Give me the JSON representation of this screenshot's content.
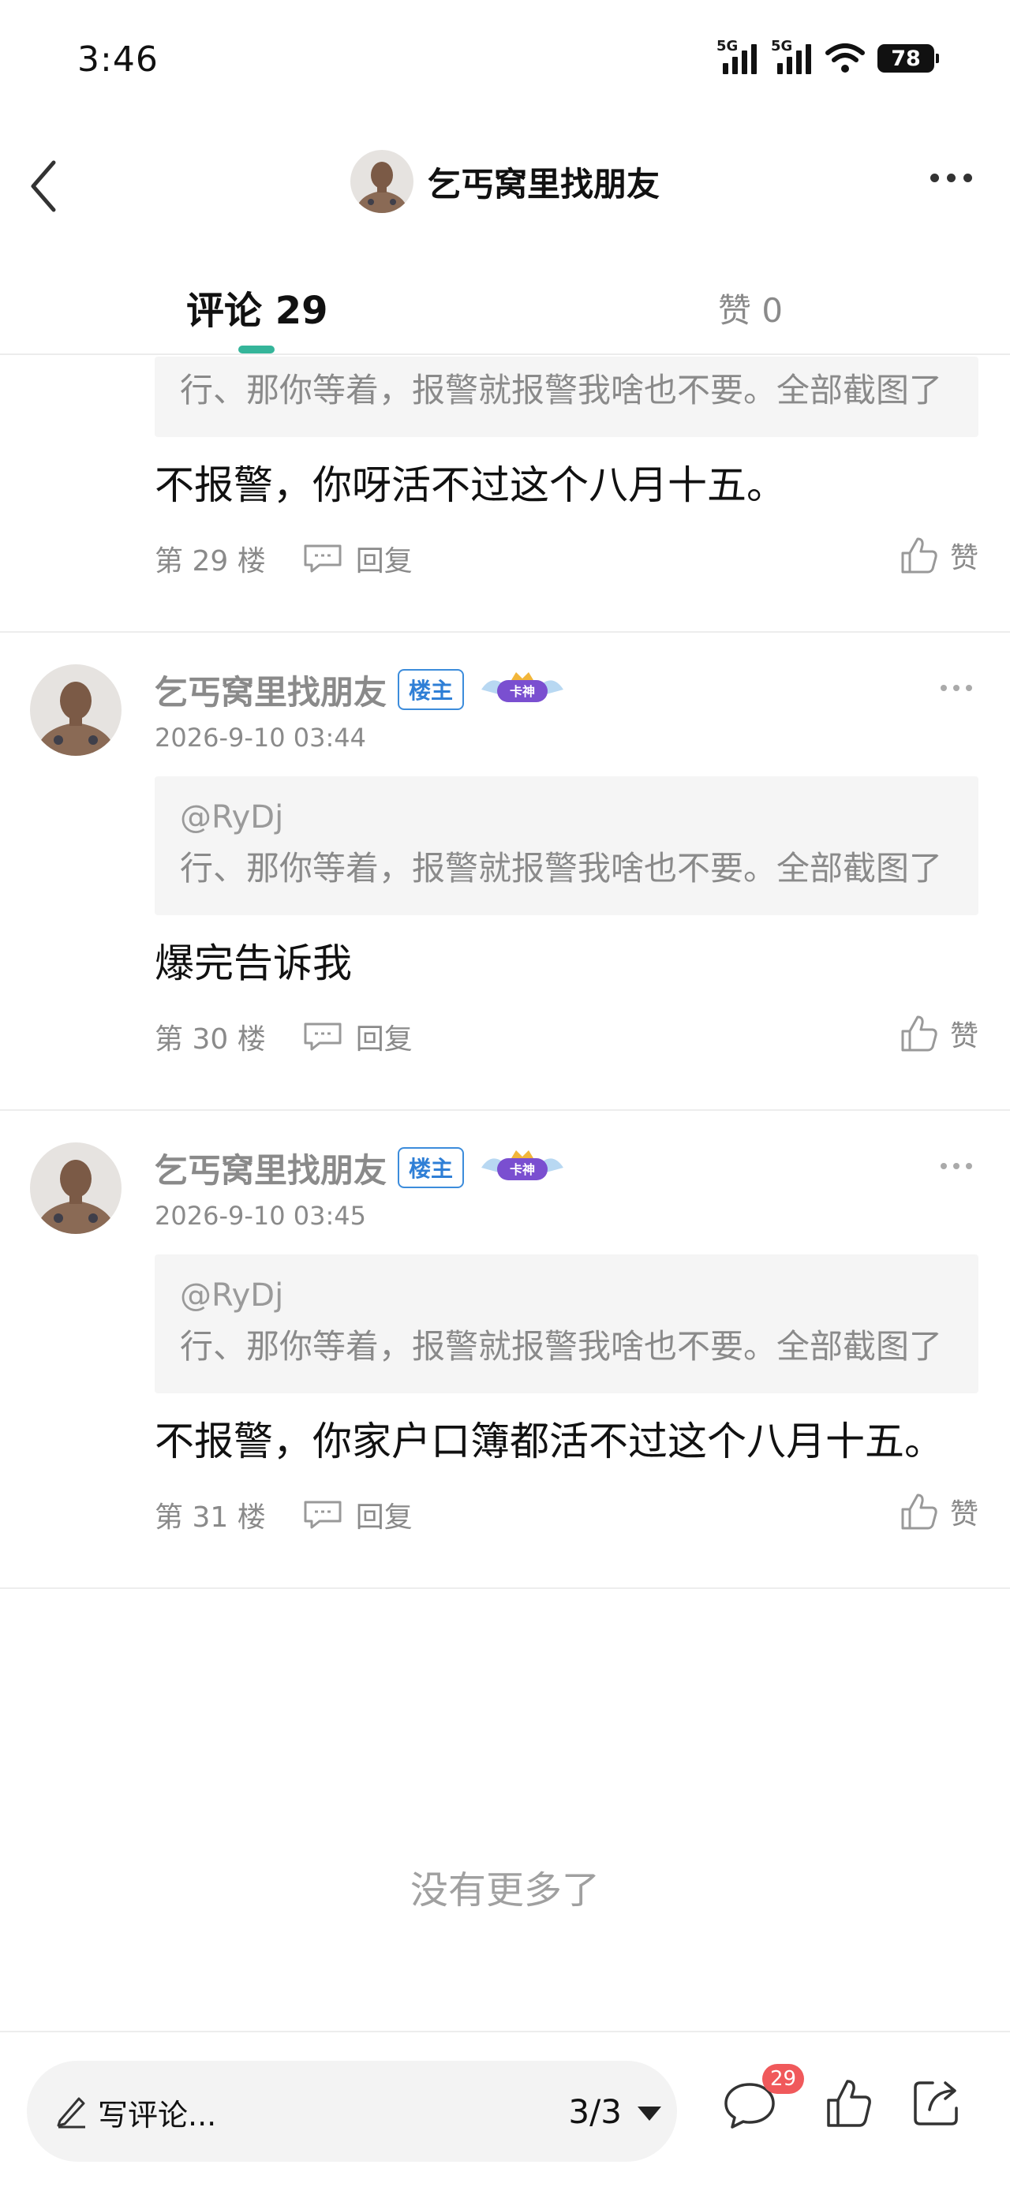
{
  "status": {
    "time": "3:46",
    "network1": "5G",
    "network2": "5G",
    "battery": "78"
  },
  "header": {
    "title": "乞丐窝里找朋友"
  },
  "tabs": {
    "comments": "评论 29",
    "likes": "赞 0"
  },
  "partial": {
    "quote": "行、那你等着，报警就报警我啥也不要。全部截图了",
    "body": "不报警，你呀活不过这个八月十五。",
    "floor": "第 29 楼",
    "reply": "回复",
    "like": "赞"
  },
  "comments": [
    {
      "name": "乞丐窝里找朋友",
      "owner_badge": "楼主",
      "card_badge": "卡神",
      "date": "2026-9-10 03:44",
      "quote_user": "@RyDj",
      "quote_text": "行、那你等着，报警就报警我啥也不要。全部截图了",
      "body": "爆完告诉我",
      "floor": "第 30 楼",
      "reply": "回复",
      "like": "赞"
    },
    {
      "name": "乞丐窝里找朋友",
      "owner_badge": "楼主",
      "card_badge": "卡神",
      "date": "2026-9-10 03:45",
      "quote_user": "@RyDj",
      "quote_text": "行、那你等着，报警就报警我啥也不要。全部截图了",
      "body": "不报警，你家户口簿都活不过这个八月十五。",
      "floor": "第 31 楼",
      "reply": "回复",
      "like": "赞"
    }
  ],
  "end_text": "没有更多了",
  "bottom": {
    "input_placeholder": "写评论...",
    "page": "3/3",
    "comment_count": "29"
  }
}
